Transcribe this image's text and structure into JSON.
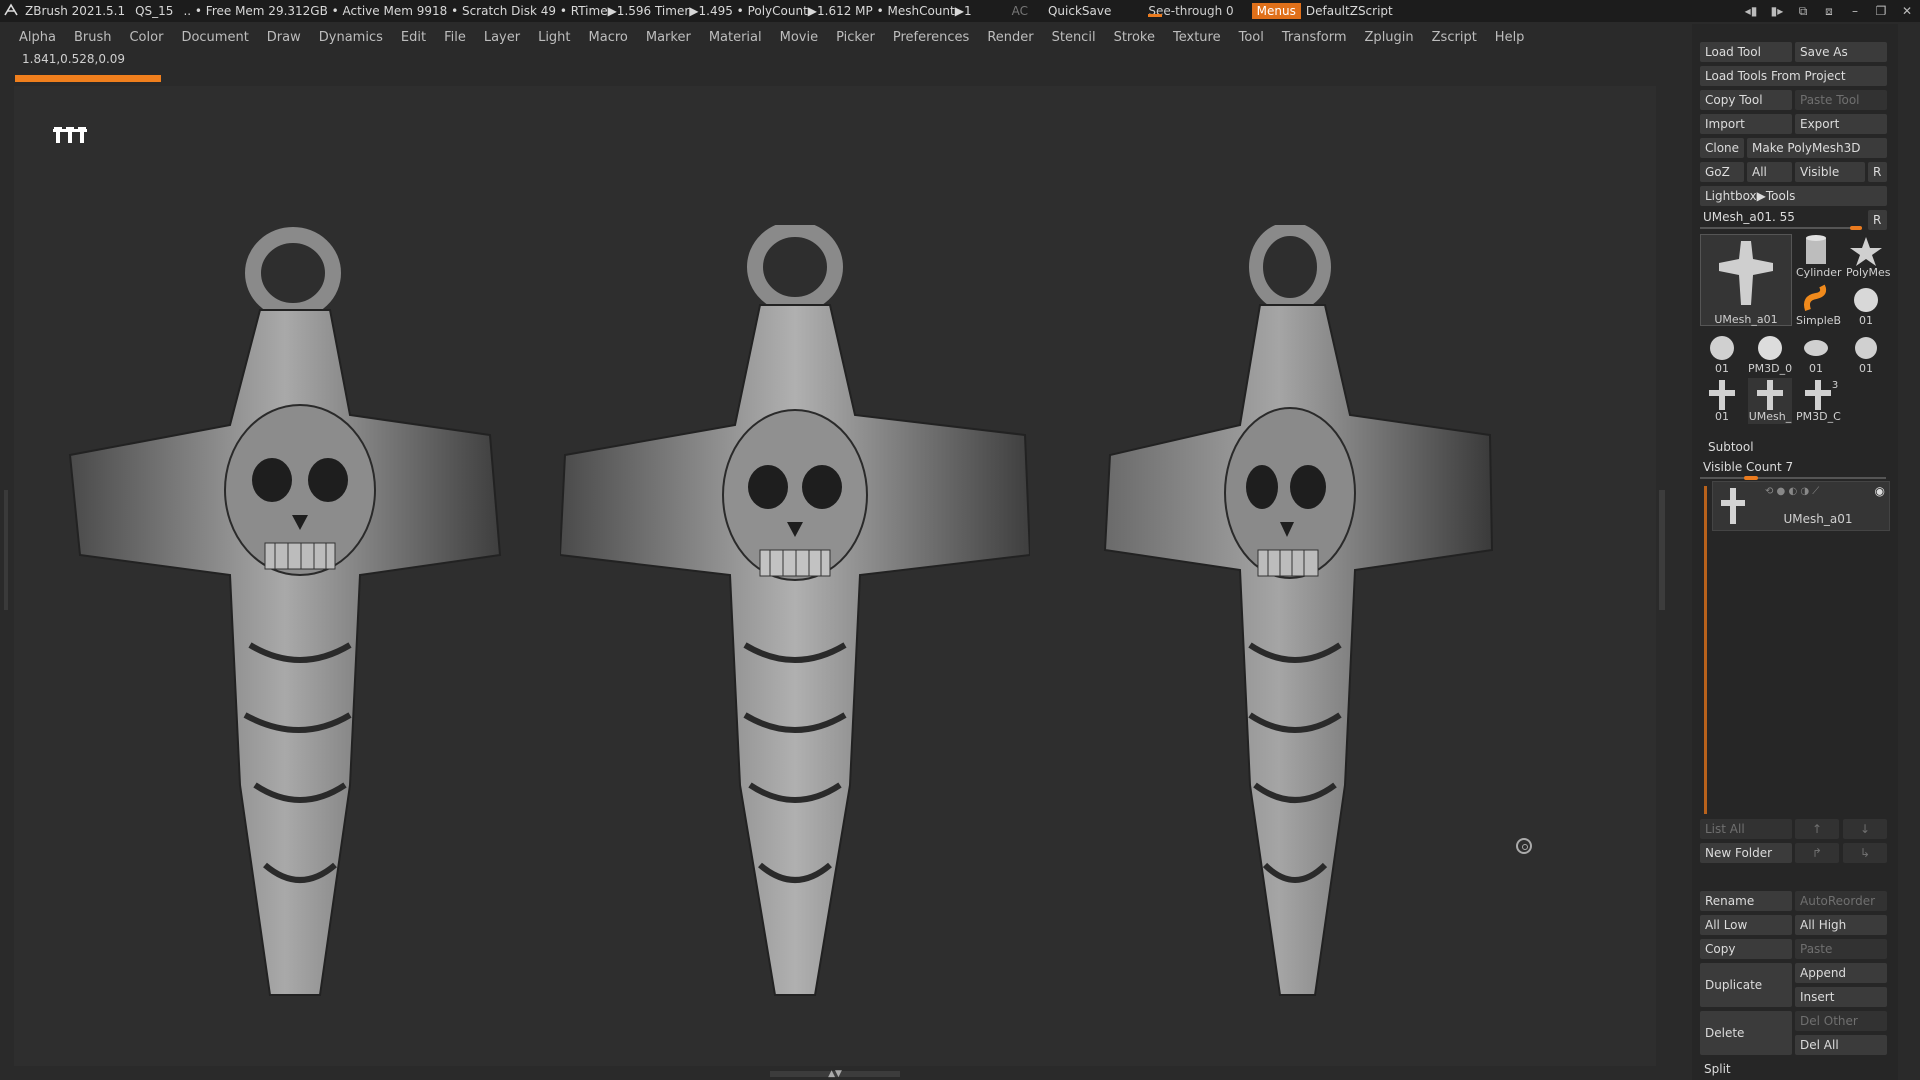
{
  "titlebar": {
    "app": "ZBrush 2021.5.1",
    "project": "QS_15",
    "stats": ".. • Free Mem 29.312GB • Active Mem 9918 • Scratch Disk 49 • RTime▶1.596 Timer▶1.495 • PolyCount▶1.612 MP • MeshCount▶1",
    "ac": "AC",
    "quicksave": "QuickSave",
    "see_through": "See-through  0",
    "menus": "Menus",
    "script": "DefaultZScript"
  },
  "menubar": [
    "Alpha",
    "Brush",
    "Color",
    "Document",
    "Draw",
    "Dynamics",
    "Edit",
    "File",
    "Layer",
    "Light",
    "Macro",
    "Marker",
    "Material",
    "Movie",
    "Picker",
    "Preferences",
    "Render",
    "Stencil",
    "Stroke",
    "Texture",
    "Tool",
    "Transform",
    "Zplugin",
    "Zscript",
    "Help"
  ],
  "viewport": {
    "coords": "1.841,0.528,0.09",
    "logo": "ꟷꟷꟷ"
  },
  "tool_panel": {
    "load_tool": "Load Tool",
    "save_as": "Save As",
    "load_from_project": "Load Tools From Project",
    "copy_tool": "Copy Tool",
    "paste_tool": "Paste Tool",
    "import": "Import",
    "export": "Export",
    "clone": "Clone",
    "make_polymesh": "Make PolyMesh3D",
    "goz": "GoZ",
    "all": "All",
    "visible": "Visible",
    "r": "R",
    "lightbox_tools": "Lightbox▶Tools",
    "current_tool": "UMesh_a01. 55",
    "thumbs": {
      "main": "UMesh_a01",
      "cylinder": "Cylinder",
      "polymesh": "PolyMes",
      "simpleb": "SimpleB",
      "t01a": "01",
      "t01b": "01",
      "pm3d": "PM3D_0",
      "t01c": "01",
      "t01d": "01",
      "t01e": "01",
      "umesh": "UMesh_",
      "pm3dc": "PM3D_C",
      "three": "3"
    }
  },
  "subtool": {
    "header": "Subtool",
    "visible_count": "Visible Count 7",
    "item_name": "UMesh_a01",
    "list_all": "List All",
    "new_folder": "New Folder",
    "rename": "Rename",
    "auto_reorder": "AutoReorder",
    "all_low": "All Low",
    "all_high": "All High",
    "copy": "Copy",
    "paste": "Paste",
    "duplicate": "Duplicate",
    "append": "Append",
    "insert": "Insert",
    "delete": "Delete",
    "del_other": "Del Other",
    "del_all": "Del All",
    "split": "Split"
  },
  "colors": {
    "accent": "#ea7b1f",
    "bg": "#2e2e2e",
    "panel": "#262626"
  }
}
